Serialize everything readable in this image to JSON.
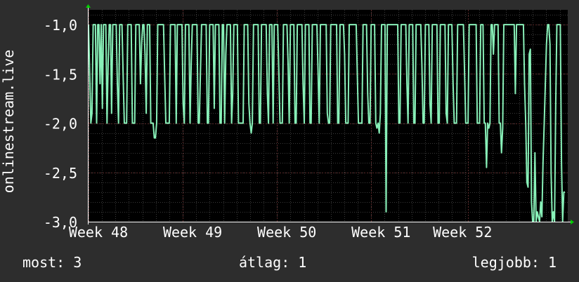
{
  "chart_data": {
    "type": "line",
    "ylabel": "onlinestream.live",
    "ylim": [
      -3.0,
      -0.85
    ],
    "yticks": [
      -1.0,
      -1.5,
      -2.0,
      -2.5,
      -3.0
    ],
    "ytick_labels": [
      "-1,0",
      "-1,5",
      "-2,0",
      "-2,5",
      "-3,0"
    ],
    "xlim": [
      0,
      35.6
    ],
    "x_tick_positions": [
      0,
      7,
      14,
      21,
      28.2
    ],
    "xtick_labels": [
      "Week 48",
      "Week 49",
      "Week 50",
      "Week 51",
      "Week 52"
    ],
    "series": [
      {
        "values": [
          -1.0,
          -1.5,
          -2.0,
          -1.9,
          -1.0,
          -1.0,
          -1.0,
          -2.0,
          -1.0,
          -1.0,
          -1.6,
          -1.0,
          -1.85,
          -1.0,
          -1.0,
          -1.0,
          -2.0,
          -1.4,
          -1.0,
          -1.0,
          -1.9,
          -1.0,
          -1.0,
          -1.0,
          -1.0,
          -1.6,
          -2.0,
          -1.0,
          -1.0,
          -1.0,
          -1.5,
          -2.0,
          -2.0,
          -2.0,
          -1.0,
          -1.0,
          -1.0,
          -1.0,
          -2.0,
          -2.0,
          -2.0,
          -1.0,
          -1.0,
          -1.0,
          -1.0,
          -1.6,
          -1.2,
          -1.0,
          -1.0,
          -1.3,
          -1.9,
          -1.0,
          -1.0,
          -1.0,
          -2.0,
          -2.0,
          -2.0,
          -2.15,
          -2.15,
          -2.0,
          -1.0,
          -1.0,
          -1.0,
          -1.0,
          -1.0,
          -1.0,
          -1.5,
          -2.0,
          -2.0,
          -2.0,
          -2.0,
          -1.0,
          -1.0,
          -1.0,
          -1.0,
          -1.0,
          -2.0,
          -1.0,
          -1.0,
          -1.0,
          -1.0,
          -1.0,
          -1.8,
          -2.0,
          -1.0,
          -1.0,
          -1.0,
          -1.0,
          -2.0,
          -1.4,
          -1.0,
          -1.0,
          -1.0,
          -1.0,
          -1.0,
          -2.0,
          -2.0,
          -1.5,
          -1.0,
          -1.0,
          -1.0,
          -1.0,
          -1.0,
          -2.0,
          -2.0,
          -1.0,
          -1.0,
          -1.0,
          -1.0,
          -1.85,
          -1.0,
          -1.0,
          -1.0,
          -1.0,
          -2.0,
          -2.0,
          -1.0,
          -1.0,
          -2.0,
          -1.3,
          -1.0,
          -1.0,
          -1.0,
          -1.0,
          -2.0,
          -1.7,
          -1.0,
          -1.0,
          -1.0,
          -1.0,
          -2.0,
          -2.0,
          -2.0,
          -2.0,
          -2.0,
          -1.0,
          -1.0,
          -1.0,
          -1.0,
          -1.8,
          -2.0,
          -2.1,
          -2.0,
          -1.0,
          -1.0,
          -1.0,
          -1.0,
          -1.0,
          -2.0,
          -2.0,
          -1.0,
          -1.0,
          -1.0,
          -1.0,
          -1.0,
          -1.7,
          -2.0,
          -1.0,
          -1.0,
          -1.0,
          -2.0,
          -1.0,
          -1.0,
          -1.0,
          -1.0,
          -1.5,
          -2.0,
          -2.0,
          -2.0,
          -1.0,
          -1.0,
          -1.0,
          -1.0,
          -1.4,
          -2.0,
          -1.0,
          -1.0,
          -1.0,
          -1.0,
          -2.0,
          -2.0,
          -1.0,
          -1.0,
          -1.0,
          -1.0,
          -1.0,
          -1.6,
          -2.0,
          -1.0,
          -1.0,
          -1.0,
          -1.0,
          -2.0,
          -2.0,
          -1.0,
          -1.0,
          -1.0,
          -1.0,
          -1.0,
          -1.5,
          -2.0,
          -1.0,
          -1.0,
          -1.0,
          -1.0,
          -1.0,
          -1.0,
          -1.9,
          -2.0,
          -2.0,
          -1.0,
          -1.0,
          -1.0,
          -1.0,
          -1.0,
          -1.0,
          -2.0,
          -2.0,
          -1.0,
          -1.0,
          -1.0,
          -1.0,
          -1.3,
          -2.0,
          -2.0,
          -2.0,
          -1.0,
          -1.0,
          -1.0,
          -1.0,
          -1.0,
          -1.0,
          -1.0,
          -1.5,
          -2.0,
          -2.0,
          -2.0,
          -2.0,
          -1.0,
          -1.0,
          -1.0,
          -1.0,
          -1.7,
          -2.0,
          -2.0,
          -1.0,
          -1.0,
          -1.0,
          -1.0,
          -2.0,
          -2.05,
          -2.0,
          -2.1,
          -1.9,
          -1.0,
          -1.0,
          -1.0,
          -1.0,
          -2.9,
          -1.0,
          -1.0,
          -1.0,
          -1.0,
          -1.0,
          -1.0,
          -1.0,
          -1.0,
          -1.0,
          -1.0,
          -2.0,
          -2.0,
          -1.0,
          -1.0,
          -1.0,
          -1.0,
          -1.0,
          -1.6,
          -2.0,
          -1.0,
          -1.0,
          -1.0,
          -1.0,
          -2.0,
          -2.0,
          -1.0,
          -1.0,
          -1.0,
          -1.0,
          -1.0,
          -1.4,
          -2.0,
          -2.0,
          -1.0,
          -1.0,
          -1.0,
          -1.0,
          -1.8,
          -2.0,
          -1.0,
          -1.0,
          -1.0,
          -1.0,
          -1.0,
          -2.0,
          -2.0,
          -1.0,
          -1.0,
          -1.0,
          -1.0,
          -1.0,
          -1.9,
          -2.0,
          -1.0,
          -1.0,
          -1.0,
          -1.0,
          -1.6,
          -2.0,
          -2.0,
          -2.0,
          -1.0,
          -1.0,
          -1.0,
          -1.0,
          -1.0,
          -1.0,
          -1.5,
          -2.0,
          -2.0,
          -2.0,
          -1.0,
          -1.0,
          -1.0,
          -1.0,
          -1.0,
          -1.0,
          -1.0,
          -2.0,
          -2.0,
          -2.0,
          -1.0,
          -1.0,
          -1.0,
          -2.0,
          -2.0,
          -2.45,
          -2.0,
          -2.05,
          -2.0,
          -1.0,
          -1.0,
          -1.3,
          -1.0,
          -1.0,
          -1.0,
          -1.0,
          -2.0,
          -2.0,
          -2.3,
          -2.05,
          -1.0,
          -1.0,
          -1.0,
          -1.0,
          -1.0,
          -1.0,
          -1.0,
          -1.0,
          -1.0,
          -1.0,
          -1.7,
          -1.0,
          -1.0,
          -1.0,
          -1.0,
          -1.0,
          -1.0,
          -1.0,
          -1.6,
          -2.0,
          -2.6,
          -2.65,
          -1.3,
          -1.25,
          -2.8,
          -3.0,
          -3.0,
          -2.3,
          -3.0,
          -2.9,
          -2.95,
          -3.0,
          -2.8,
          -2.95,
          -2.4,
          -2.0,
          -1.6,
          -1.2,
          -1.0,
          -1.0,
          -1.2,
          -2.5,
          -3.0,
          -2.9,
          -3.0,
          -1.8,
          -1.0,
          -1.0,
          -1.0,
          -1.0,
          -2.4,
          -3.0,
          -2.7,
          -2.7
        ]
      }
    ],
    "grid": true,
    "legend": [
      {
        "label": "most:",
        "value": "3"
      },
      {
        "label": "átlag:",
        "value": "1"
      },
      {
        "label": "legjobb:",
        "value": "1"
      }
    ],
    "colors": {
      "background": "#2d2d2d",
      "plot_background": "#000000",
      "grid_major": "#3a3a3a",
      "grid_minor": "#5a2a2a",
      "line": "#88f0b8",
      "axis_arrow": "#00d000",
      "text": "#ffffff"
    }
  }
}
